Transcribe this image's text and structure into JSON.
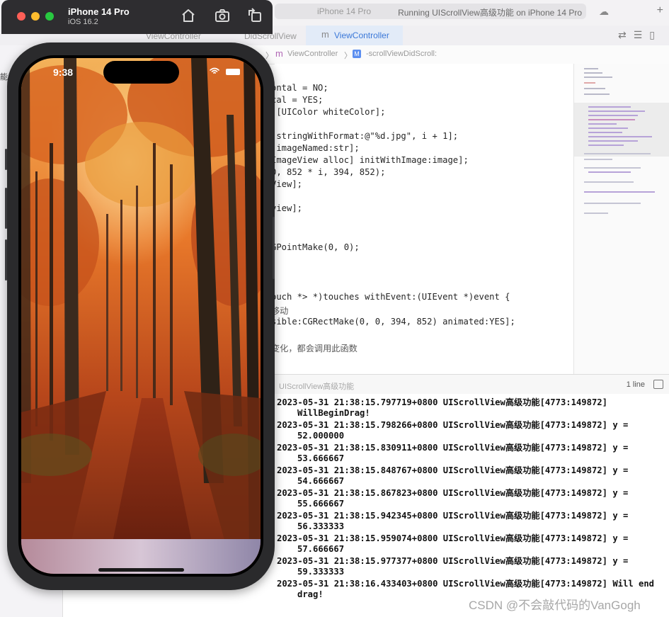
{
  "simulator": {
    "device_name": "iPhone 14 Pro",
    "os_version": "iOS 16.2",
    "status_time": "9:38",
    "icons": [
      "home-icon",
      "screenshot-icon",
      "rotate-icon"
    ]
  },
  "xcode": {
    "toolbar": {
      "breadcrumb_1": "能",
      "breadcrumb_2": "iPhone 14 Pro",
      "run_status": "Running UIScrollView高级功能 on iPhone 14 Pro"
    },
    "tabs": [
      {
        "label": "ViewController"
      },
      {
        "label": "DidScrollView"
      },
      {
        "label": "ViewController"
      }
    ],
    "jumpbar": {
      "file": "ViewController",
      "method": "-scrollViewDidScroll:"
    },
    "left_nav": "能",
    "code_lines": [
      {
        "text": "ontal = NO;"
      },
      {
        "text": "cal = YES;"
      },
      {
        "text": " [UIColor whiteColor];"
      },
      {
        "text": ""
      },
      {
        "text": " stringWithFormat:@\"%d.jpg\", i + 1];"
      },
      {
        "text": " imageNamed:str];"
      },
      {
        "text": "ImageView alloc] initWithImage:image];"
      },
      {
        "text": "0, 852 * i, 394, 852);"
      },
      {
        "text": "View];"
      },
      {
        "text": ""
      },
      {
        "text": "view];"
      },
      {
        "text": ""
      },
      {
        "text": ""
      },
      {
        "text": "GPointMake(0, 0);"
      },
      {
        "text": ""
      },
      {
        "text": ""
      },
      {
        "text": ""
      },
      {
        "text": "ouch *> *)touches withEvent:(UIEvent *)event {"
      },
      {
        "text": "移动"
      },
      {
        "text": "sible:CGRectMake(0, 0, 394, 852) animated:YES];"
      },
      {
        "text": ""
      },
      {
        "text": "变化，都会调用此函数"
      }
    ],
    "debug": {
      "target": "UIScrollView高级功能",
      "line_count": "1 line"
    },
    "console_logs": [
      {
        "line": "2023-05-31 21:38:15.797719+0800 UIScrollView高级功能[4773:149872]",
        "cont": "WillBeginDrag!"
      },
      {
        "line": "2023-05-31 21:38:15.798266+0800 UIScrollView高级功能[4773:149872] y =",
        "cont": "52.000000"
      },
      {
        "line": "2023-05-31 21:38:15.830911+0800 UIScrollView高级功能[4773:149872] y =",
        "cont": "53.666667"
      },
      {
        "line": "2023-05-31 21:38:15.848767+0800 UIScrollView高级功能[4773:149872] y =",
        "cont": "54.666667"
      },
      {
        "line": "2023-05-31 21:38:15.867823+0800 UIScrollView高级功能[4773:149872] y =",
        "cont": "55.666667"
      },
      {
        "line": "2023-05-31 21:38:15.942345+0800 UIScrollView高级功能[4773:149872] y =",
        "cont": "56.333333"
      },
      {
        "line": "2023-05-31 21:38:15.959074+0800 UIScrollView高级功能[4773:149872] y =",
        "cont": "57.666667"
      },
      {
        "line": "2023-05-31 21:38:15.977377+0800 UIScrollView高级功能[4773:149872] y =",
        "cont": "59.333333"
      },
      {
        "line": "2023-05-31 21:38:16.433403+0800 UIScrollView高级功能[4773:149872] Will end",
        "cont": "drag!"
      }
    ]
  },
  "watermark": "CSDN @不会敲代码的VanGogh",
  "colors": {
    "traffic_close": "#fe5f57",
    "traffic_min": "#febc2e",
    "traffic_max": "#28c840",
    "simulator_titlebar": "#2e2d30",
    "active_tab": "#3b78d8"
  }
}
